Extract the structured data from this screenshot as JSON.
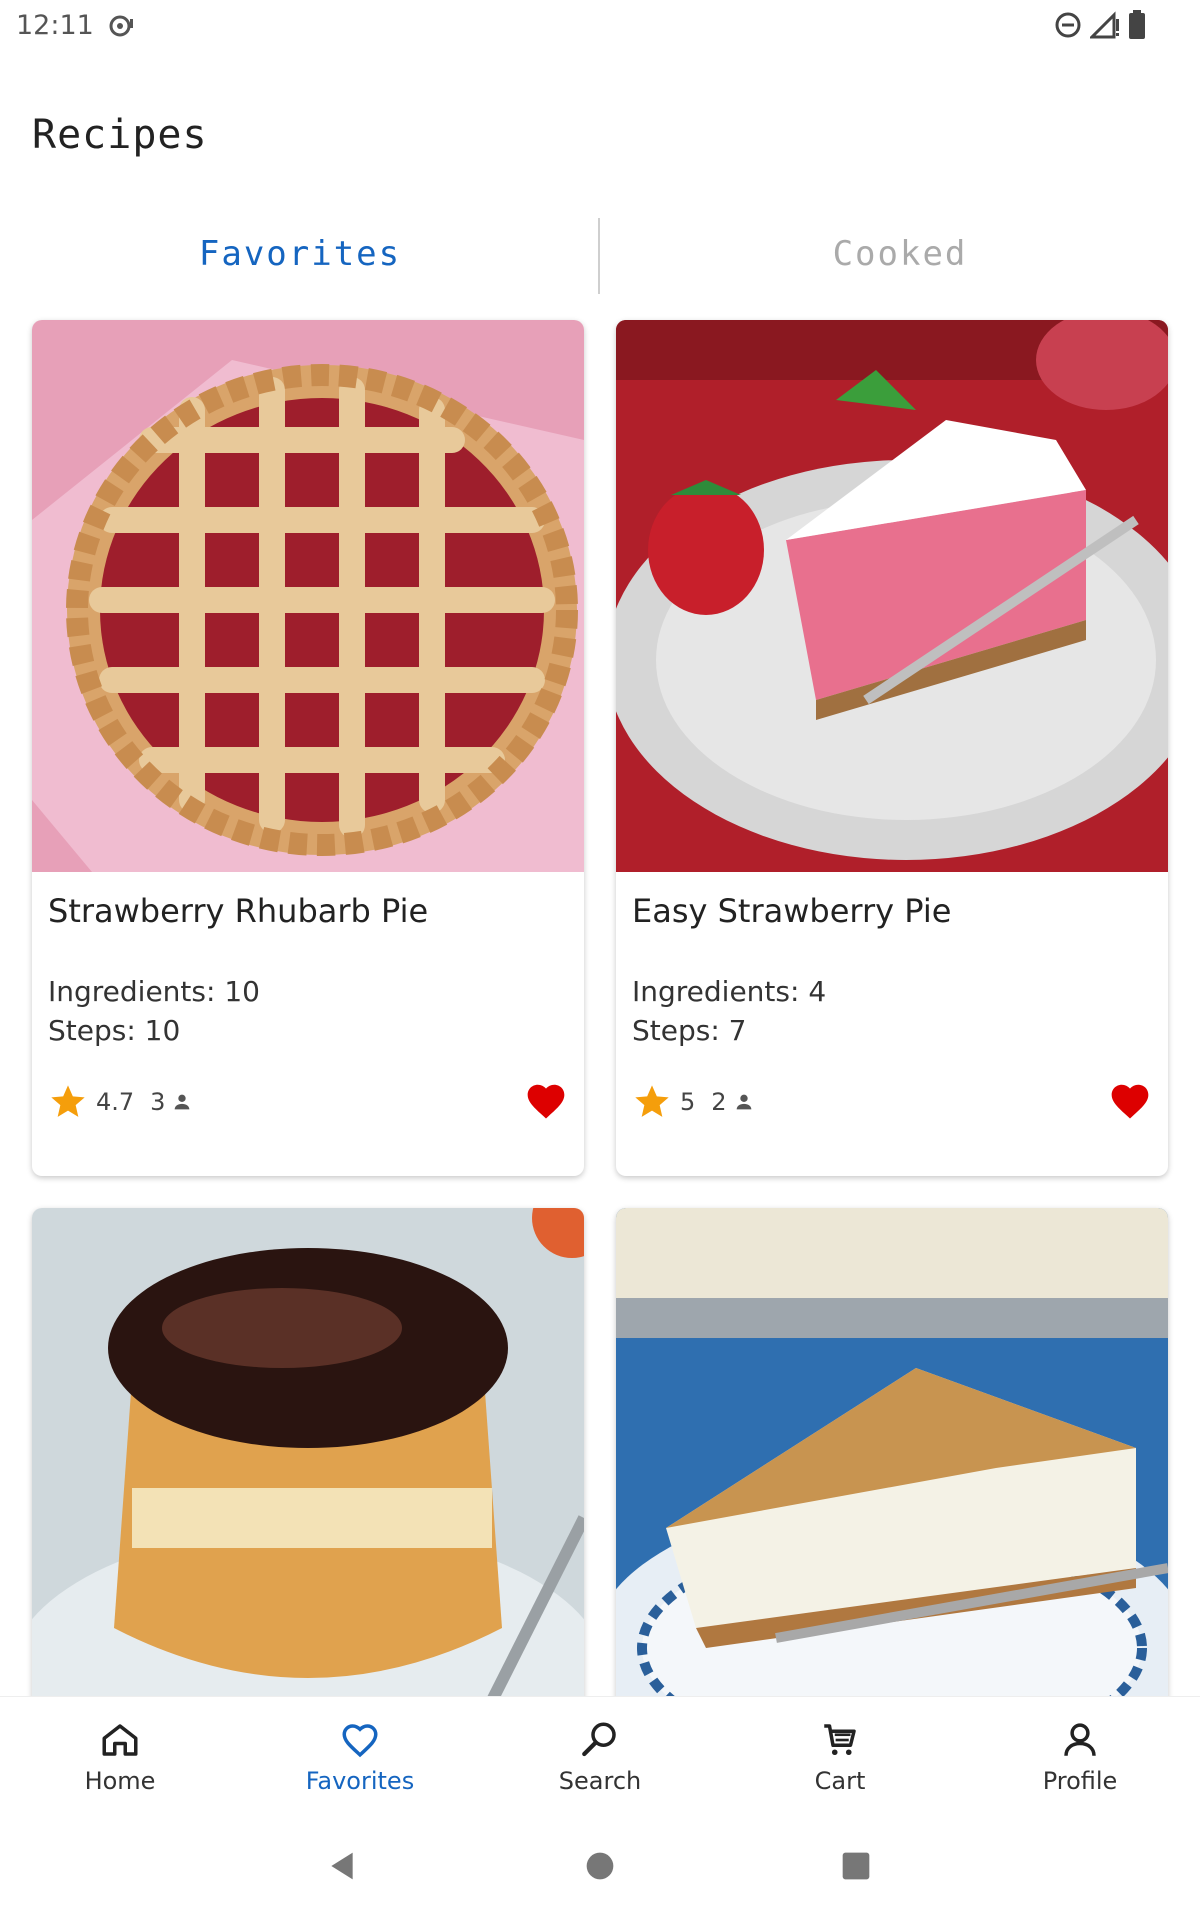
{
  "status_bar": {
    "time": "12:11"
  },
  "header": {
    "title": "Recipes"
  },
  "tabs": [
    {
      "label": "Favorites",
      "active": true
    },
    {
      "label": "Cooked",
      "active": false
    }
  ],
  "recipes": [
    {
      "title": "Strawberry Rhubarb Pie",
      "ingredients": "Ingredients: 10",
      "steps": "Steps: 10",
      "rating": "4.7",
      "reviews": "3",
      "favorite": true
    },
    {
      "title": "Easy Strawberry Pie",
      "ingredients": "Ingredients: 4",
      "steps": "Steps: 7",
      "rating": "5",
      "reviews": "2",
      "favorite": true
    },
    {
      "title": "",
      "image": "boston-cream-cupcake"
    },
    {
      "title": "",
      "image": "toffee-cream-pie"
    }
  ],
  "bottom_nav": [
    {
      "label": "Home",
      "icon": "home-icon"
    },
    {
      "label": "Favorites",
      "icon": "heart-outline-icon",
      "active": true
    },
    {
      "label": "Search",
      "icon": "search-icon"
    },
    {
      "label": "Cart",
      "icon": "cart-icon"
    },
    {
      "label": "Profile",
      "icon": "person-icon"
    }
  ],
  "colors": {
    "accent": "#1565c0",
    "star": "#f59e0b",
    "heart": "#dd0000",
    "inactive_tab": "#aaaaaa"
  }
}
